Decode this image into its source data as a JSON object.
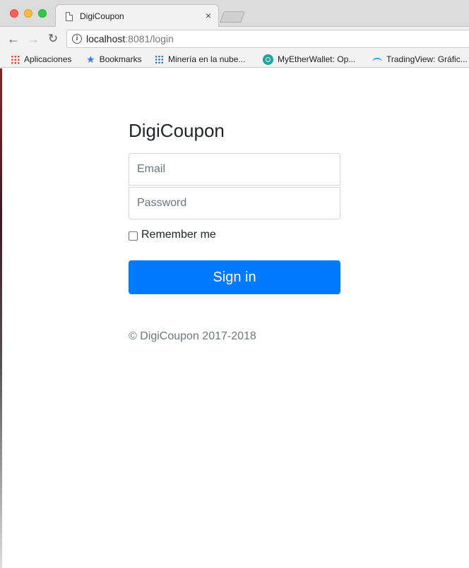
{
  "browser": {
    "tab_title": "DigiCoupon",
    "tab_close": "×",
    "url_host": "localhost",
    "url_path": ":8081/login",
    "nav": {
      "back": "←",
      "forward": "→",
      "reload": "↻"
    },
    "info": "i"
  },
  "bookmarks": [
    {
      "label": "Aplicaciones",
      "icon": "apps-icon"
    },
    {
      "label": "Bookmarks",
      "icon": "star-icon"
    },
    {
      "label": "Minería en la nube...",
      "icon": "mineria-icon"
    },
    {
      "label": "MyEtherWallet: Op...",
      "icon": "mew-icon"
    },
    {
      "label": "TradingView: Gráfic...",
      "icon": "tradingview-icon"
    }
  ],
  "login": {
    "brand": "DigiCoupon",
    "email_placeholder": "Email",
    "password_placeholder": "Password",
    "remember_label": "Remember me",
    "signin_label": "Sign in",
    "footer": "© DigiCoupon 2017-2018"
  },
  "colors": {
    "primary": "#007bff",
    "muted_text": "#6c757d",
    "body_text": "#212529"
  }
}
